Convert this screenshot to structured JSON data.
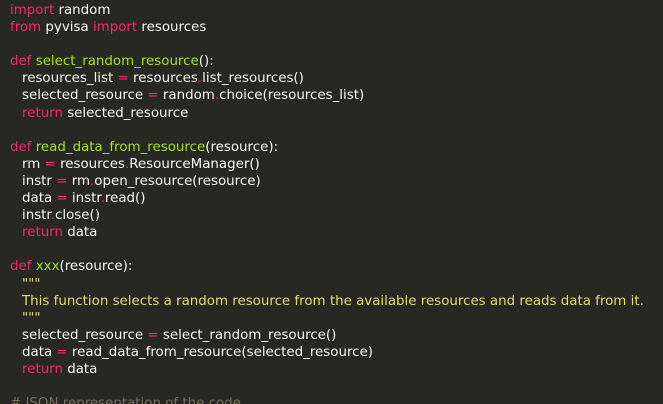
{
  "editor": {
    "theme_colors": {
      "background": "#272822",
      "keyword": "#f92672",
      "function_name": "#a6e22e",
      "parameter": "#fd971f",
      "string": "#e6db74",
      "comment": "#75715e",
      "text": "#f8f8f2"
    },
    "lines": [
      {
        "tokens": [
          {
            "t": "kw",
            "v": "import"
          },
          {
            "t": "plain",
            "v": " random"
          }
        ]
      },
      {
        "tokens": [
          {
            "t": "kw",
            "v": "from"
          },
          {
            "t": "plain",
            "v": " pyvisa "
          },
          {
            "t": "kw",
            "v": "import"
          },
          {
            "t": "plain",
            "v": " resources"
          }
        ]
      },
      {
        "tokens": []
      },
      {
        "tokens": [
          {
            "t": "kw",
            "v": "def"
          },
          {
            "t": "plain",
            "v": " "
          },
          {
            "t": "fn",
            "v": "select_random_resource"
          },
          {
            "t": "plain",
            "v": "():"
          }
        ]
      },
      {
        "indent": 1,
        "tokens": [
          {
            "t": "plain",
            "v": "resources_list "
          },
          {
            "t": "kw",
            "v": "="
          },
          {
            "t": "plain",
            "v": " resources"
          },
          {
            "t": "kw",
            "v": "."
          },
          {
            "t": "plain",
            "v": "list_resources()"
          }
        ]
      },
      {
        "indent": 1,
        "tokens": [
          {
            "t": "plain",
            "v": "selected_resource "
          },
          {
            "t": "kw",
            "v": "="
          },
          {
            "t": "plain",
            "v": " random"
          },
          {
            "t": "kw",
            "v": "."
          },
          {
            "t": "plain",
            "v": "choice(resources_list)"
          }
        ]
      },
      {
        "indent": 1,
        "tokens": [
          {
            "t": "kw",
            "v": "return"
          },
          {
            "t": "plain",
            "v": " selected_resource"
          }
        ]
      },
      {
        "tokens": []
      },
      {
        "tokens": [
          {
            "t": "kw",
            "v": "def"
          },
          {
            "t": "plain",
            "v": " "
          },
          {
            "t": "fn",
            "v": "read_data_from_resource"
          },
          {
            "t": "plain",
            "v": "("
          },
          {
            "t": "plain",
            "v": "resource"
          },
          {
            "t": "plain",
            "v": "):"
          }
        ]
      },
      {
        "indent": 1,
        "tokens": [
          {
            "t": "plain",
            "v": "rm "
          },
          {
            "t": "kw",
            "v": "="
          },
          {
            "t": "plain",
            "v": " resources"
          },
          {
            "t": "kw",
            "v": "."
          },
          {
            "t": "plain",
            "v": "ResourceManager()"
          }
        ]
      },
      {
        "indent": 1,
        "tokens": [
          {
            "t": "plain",
            "v": "instr "
          },
          {
            "t": "kw",
            "v": "="
          },
          {
            "t": "plain",
            "v": " rm"
          },
          {
            "t": "kw",
            "v": "."
          },
          {
            "t": "plain",
            "v": "open_resource(resource)"
          }
        ]
      },
      {
        "indent": 1,
        "tokens": [
          {
            "t": "plain",
            "v": "data "
          },
          {
            "t": "kw",
            "v": "="
          },
          {
            "t": "plain",
            "v": " instr"
          },
          {
            "t": "kw",
            "v": "."
          },
          {
            "t": "plain",
            "v": "read()"
          }
        ]
      },
      {
        "indent": 1,
        "tokens": [
          {
            "t": "plain",
            "v": "instr"
          },
          {
            "t": "kw",
            "v": "."
          },
          {
            "t": "plain",
            "v": "close()"
          }
        ]
      },
      {
        "indent": 1,
        "tokens": [
          {
            "t": "kw",
            "v": "return"
          },
          {
            "t": "plain",
            "v": " data"
          }
        ]
      },
      {
        "tokens": []
      },
      {
        "tokens": [
          {
            "t": "kw",
            "v": "def"
          },
          {
            "t": "plain",
            "v": " "
          },
          {
            "t": "fn",
            "v": "xxx"
          },
          {
            "t": "plain",
            "v": "(resource):"
          }
        ]
      },
      {
        "indent": 1,
        "tokens": [
          {
            "t": "str",
            "v": "\"\"\""
          }
        ]
      },
      {
        "indent": 1,
        "tokens": [
          {
            "t": "str",
            "v": "This function selects a random resource from the available resources and reads data from it."
          }
        ]
      },
      {
        "indent": 1,
        "tokens": [
          {
            "t": "str",
            "v": "\"\"\""
          }
        ]
      },
      {
        "indent": 1,
        "tokens": [
          {
            "t": "plain",
            "v": "selected_resource "
          },
          {
            "t": "kw",
            "v": "="
          },
          {
            "t": "plain",
            "v": " select_random_resource()"
          }
        ]
      },
      {
        "indent": 1,
        "tokens": [
          {
            "t": "plain",
            "v": "data "
          },
          {
            "t": "kw",
            "v": "="
          },
          {
            "t": "plain",
            "v": " read_data_from_resource(selected_resource)"
          }
        ]
      },
      {
        "indent": 1,
        "tokens": [
          {
            "t": "kw",
            "v": "return"
          },
          {
            "t": "plain",
            "v": " data"
          }
        ]
      },
      {
        "tokens": []
      },
      {
        "tokens": [
          {
            "t": "cmt",
            "v": "# JSON representation of the code"
          }
        ]
      }
    ]
  }
}
